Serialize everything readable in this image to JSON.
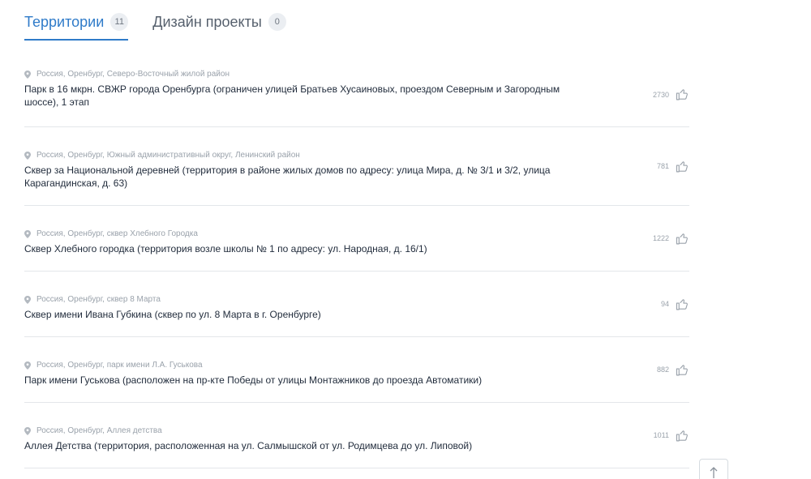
{
  "tabs": [
    {
      "label": "Территории",
      "count": "11",
      "active": true
    },
    {
      "label": "Дизайн проекты",
      "count": "0",
      "active": false
    }
  ],
  "items": [
    {
      "location": "Россия, Оренбург, Северо-Восточный жилой район",
      "title": "Парк в 16 мкрн. СВЖР города Оренбурга (ограничен улицей Братьев Хусаиновых, проездом Северным и Загородным шоссе), 1 этап",
      "likes": "2730"
    },
    {
      "location": "Россия, Оренбург, Южный административный округ, Ленинский район",
      "title": "Сквер за Национальной деревней (территория в районе жилых домов по адресу: улица Мира, д. № 3/1 и 3/2, улица Карагандинская, д. 63)",
      "likes": "781"
    },
    {
      "location": "Россия, Оренбург, сквер Хлебного Городка",
      "title": "Сквер Хлебного городка (территория возле школы № 1 по адресу: ул. Народная, д. 16/1)",
      "likes": "1222"
    },
    {
      "location": "Россия, Оренбург, сквер 8 Марта",
      "title": "Сквер имени Ивана Губкина (сквер по ул. 8 Марта в г. Оренбурге)",
      "likes": "94"
    },
    {
      "location": "Россия, Оренбург, парк имени Л.А. Гуськова",
      "title": "Парк имени Гуськова (расположен на пр-кте Победы от улицы Монтажников до проезда Автоматики)",
      "likes": "882"
    },
    {
      "location": "Россия, Оренбург, Аллея детства",
      "title": "Аллея Детства (территория, расположенная на ул. Салмышской от ул. Родимцева до ул. Липовой)",
      "likes": "1011"
    }
  ],
  "icons": {
    "location": "location-pin-icon",
    "like": "thumbs-up-icon",
    "scroll_top": "arrow-up-icon"
  },
  "colors": {
    "accent": "#2f7bc9",
    "text": "#1f2a3a",
    "muted": "#9aa2ab",
    "divider": "#e3e6ea"
  }
}
